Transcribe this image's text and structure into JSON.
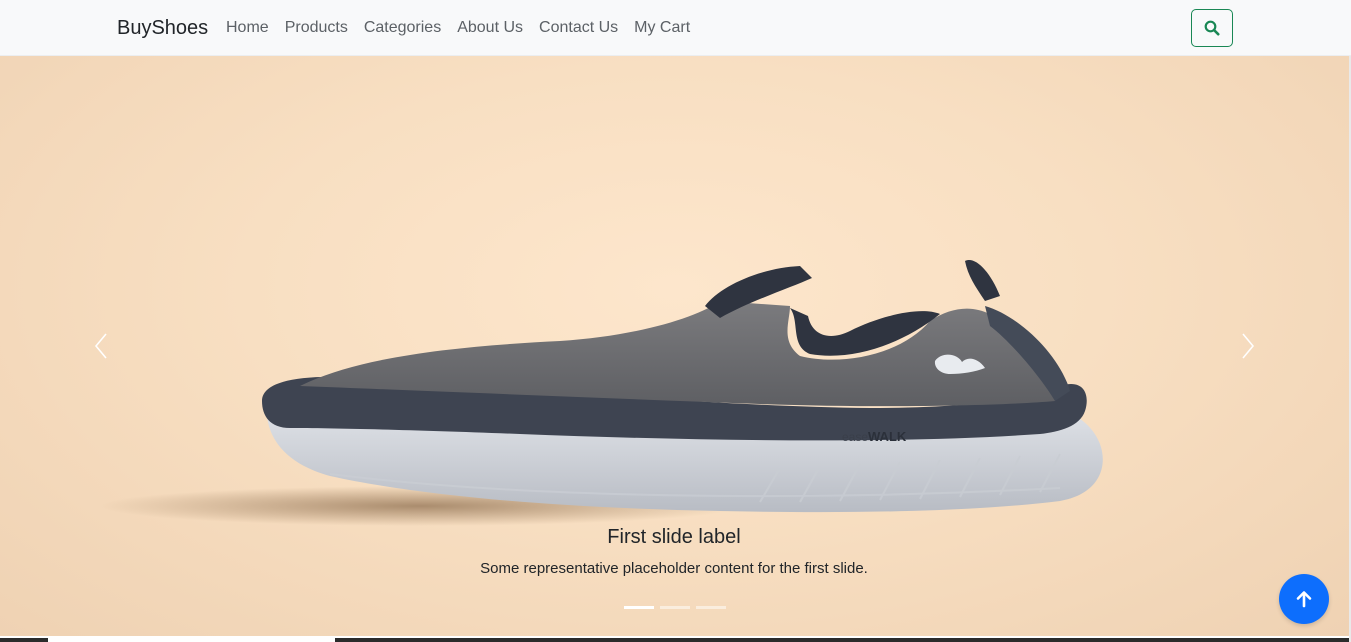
{
  "navbar": {
    "brand": "BuyShoes",
    "links": [
      "Home",
      "Products",
      "Categories",
      "About Us",
      "Contact Us",
      "My Cart"
    ],
    "search_icon": "search-icon"
  },
  "carousel": {
    "slides": [
      {
        "title": "First slide label",
        "text": "Some representative placeholder content for the first slide.",
        "image_brand_text": "easeWALK"
      }
    ],
    "indicator_count": 3,
    "active_index": 0,
    "prev_icon": "chevron-left-icon",
    "next_icon": "chevron-right-icon"
  },
  "back_to_top": {
    "icon": "arrow-up-icon"
  },
  "colors": {
    "accent": "#198754",
    "primary": "#0d6efd",
    "navbar_bg": "#f8f9fa",
    "hero_bg": "#f8dfc2"
  }
}
